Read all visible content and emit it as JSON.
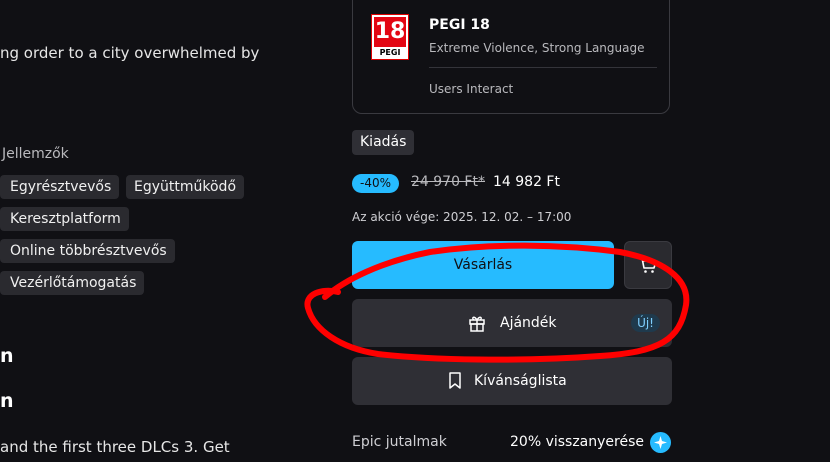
{
  "left": {
    "description_top": "ng order to a city overwhelmed by",
    "features_heading": "Jellemzők",
    "tags": [
      "Egyrésztvevős",
      "Együttműködő",
      "Keresztplatform",
      "Online többrésztvevős",
      "Vezérlőtámogatás"
    ],
    "heading_a": "n",
    "heading_b": "n",
    "description_bottom": "and the first three DLCs 3. Get"
  },
  "rating": {
    "badge_number": "18",
    "badge_word": "PEGI",
    "title": "PEGI 18",
    "descriptors": "Extreme Violence, Strong Language",
    "interactive": "Users Interact"
  },
  "release_chip": "Kiadás",
  "pricing": {
    "discount": "-40%",
    "original_price": "24 970 Ft*",
    "sale_price": "14 982 Ft",
    "sale_end": "Az akció vége: 2025. 12. 02. – 17:00"
  },
  "actions": {
    "buy_label": "Vásárlás",
    "gift_label": "Ajándék",
    "gift_badge": "Új!",
    "wishlist_label": "Kívánságlista"
  },
  "rewards": {
    "label": "Epic jutalmak",
    "value": "20% visszanyerése"
  },
  "colors": {
    "accent": "#26bbff",
    "background": "#101014",
    "annotation": "#ff0000"
  },
  "icons": [
    "gift-icon",
    "cart-icon",
    "bookmark-icon",
    "rewards-info-icon"
  ]
}
